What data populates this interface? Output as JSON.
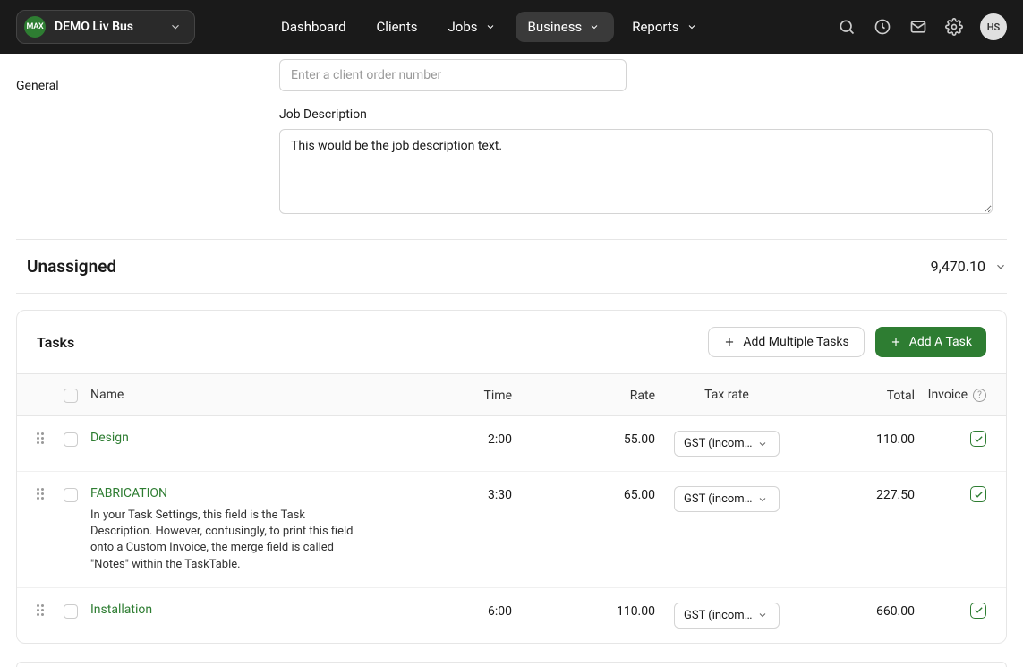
{
  "header": {
    "org_badge": "MAX",
    "org_name": "DEMO Liv Bus",
    "nav": {
      "dashboard": "Dashboard",
      "clients": "Clients",
      "jobs": "Jobs",
      "business": "Business",
      "reports": "Reports"
    },
    "avatar": "HS"
  },
  "sidebar": {
    "general_label": "General"
  },
  "form": {
    "client_order_placeholder": "Enter a client order number",
    "job_description_label": "Job Description",
    "job_description_value": "This would be the job description text."
  },
  "section": {
    "title": "Unassigned",
    "total": "9,470.10"
  },
  "tasks": {
    "card_title": "Tasks",
    "add_multiple_label": "Add Multiple Tasks",
    "add_task_label": "Add A Task",
    "columns": {
      "name": "Name",
      "time": "Time",
      "rate": "Rate",
      "tax_rate": "Tax rate",
      "total": "Total",
      "invoice": "Invoice"
    },
    "rows": [
      {
        "name": "Design",
        "description": "",
        "time": "2:00",
        "rate": "55.00",
        "tax": "GST (income...",
        "total": "110.00"
      },
      {
        "name": "FABRICATION",
        "description": "In your Task Settings, this field is the Task Description. However, confusingly, to print this field onto a Custom Invoice, the merge field is called \"Notes\" within the TaskTable.",
        "time": "3:30",
        "rate": "65.00",
        "tax": "GST (income...",
        "total": "227.50"
      },
      {
        "name": "Installation",
        "description": "",
        "time": "6:00",
        "rate": "110.00",
        "tax": "GST (income...",
        "total": "660.00"
      }
    ]
  }
}
